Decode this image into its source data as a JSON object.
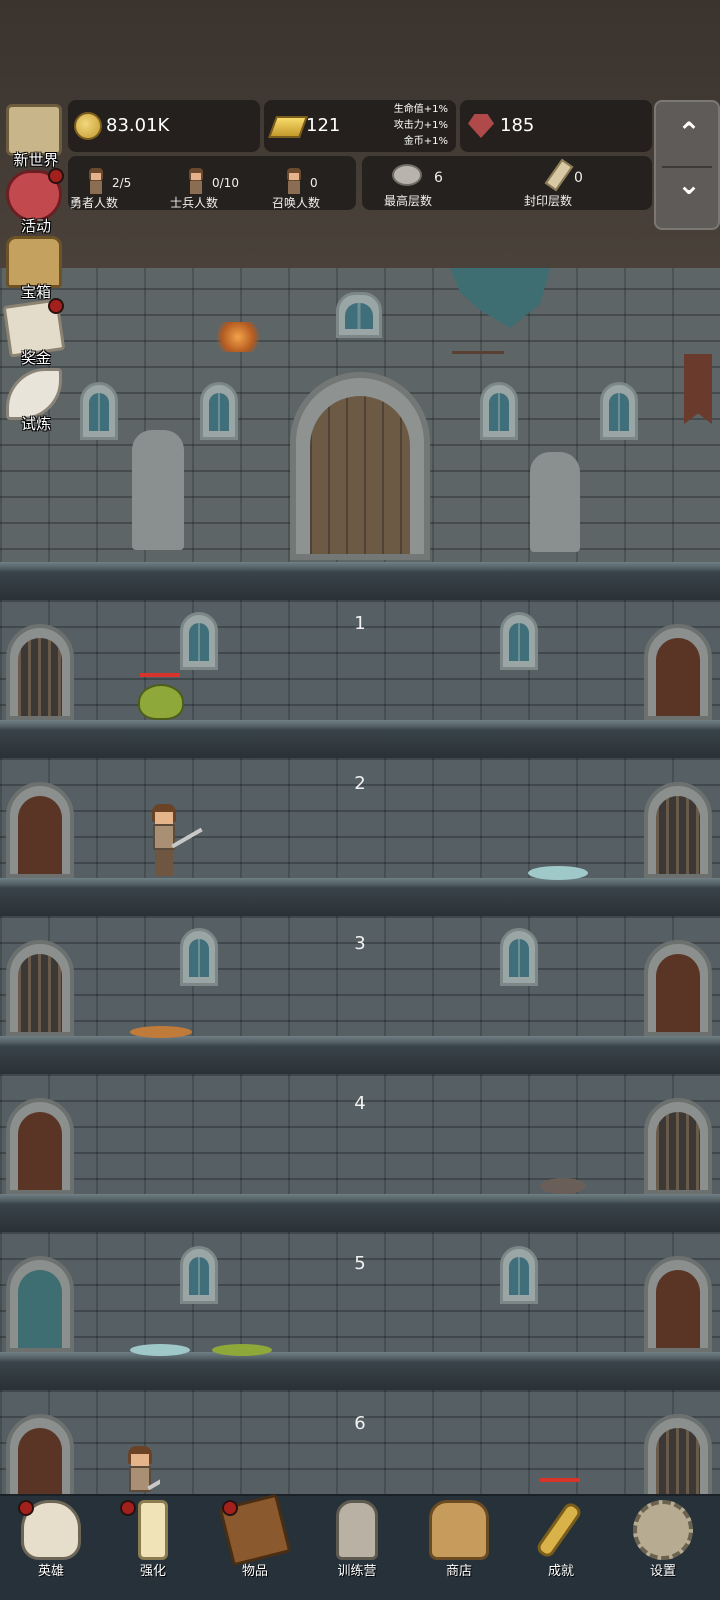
{
  "resources": {
    "gold": "83.01K",
    "gold_bars": "121",
    "bonus_lines": [
      "生命值+1%",
      "攻击力+1%",
      "金币+1%"
    ],
    "gems": "185"
  },
  "counters": {
    "heroes": {
      "value": "2/5",
      "label": "勇者人数"
    },
    "soldiers": {
      "value": "0/10",
      "label": "士兵人数"
    },
    "summons": {
      "value": "0",
      "label": "召唤人数"
    },
    "highest_floor": {
      "value": "6",
      "label": "最高层数"
    },
    "sealed_floors": {
      "value": "0",
      "label": "封印层数"
    }
  },
  "scroll_buttons": {
    "up": "⌃",
    "down": "⌄"
  },
  "side_menu": [
    {
      "label": "新世界",
      "icon": "map-icon",
      "badge": false
    },
    {
      "label": "活动",
      "icon": "heart-icon",
      "badge": true
    },
    {
      "label": "宝箱",
      "icon": "chest-icon",
      "badge": false
    },
    {
      "label": "奖金",
      "icon": "letter-icon",
      "badge": true
    },
    {
      "label": "试炼",
      "icon": "feather-icon",
      "badge": false
    }
  ],
  "floors": [
    "1",
    "2",
    "3",
    "4",
    "5",
    "6"
  ],
  "bottom_nav": [
    {
      "label": "英雄",
      "icon": "skull-icon",
      "badge": true
    },
    {
      "label": "强化",
      "icon": "candle-icon",
      "badge": true
    },
    {
      "label": "物品",
      "icon": "book-icon",
      "badge": true
    },
    {
      "label": "训练营",
      "icon": "lantern-icon",
      "badge": false
    },
    {
      "label": "商店",
      "icon": "beer-icon",
      "badge": false
    },
    {
      "label": "成就",
      "icon": "key-icon",
      "badge": false
    },
    {
      "label": "设置",
      "icon": "gear-icon",
      "badge": false
    }
  ],
  "colors": {
    "accent_red": "#a3211c",
    "hp_red": "#d8342c",
    "slime_green": "#8fa83a",
    "slime_blue": "#9fc8c9"
  }
}
